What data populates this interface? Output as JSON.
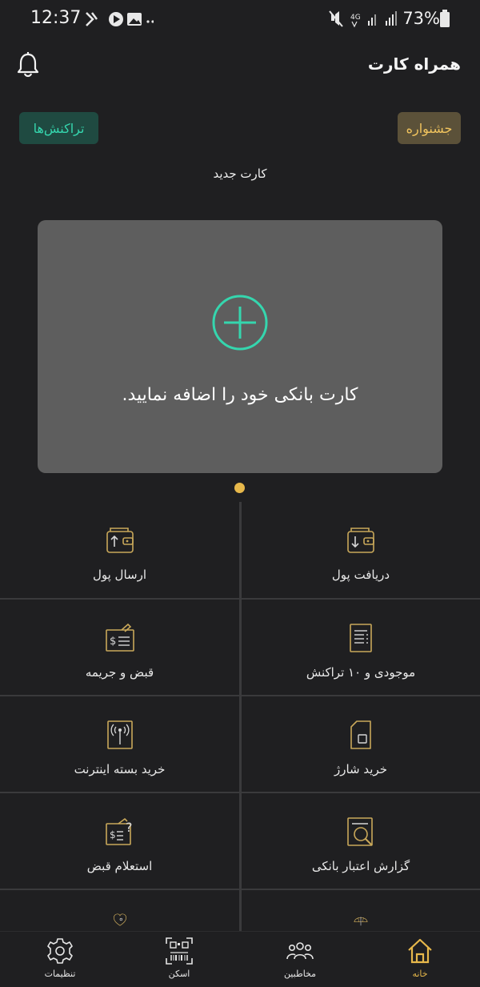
{
  "status_bar": {
    "time": "12:37",
    "network": "4G",
    "battery": "73%"
  },
  "header": {
    "title": "همراه کارت",
    "bell_icon": "bell-icon"
  },
  "top_actions": {
    "transactions_label": "تراکنش‌ها",
    "festival_label": "جشنواره"
  },
  "card_section": {
    "title": "کارت جدید",
    "hint": "کارت بانکی خود را اضافه نمایید."
  },
  "services": [
    {
      "label": "دریافت پول",
      "icon": "wallet-receive-icon"
    },
    {
      "label": "ارسال پول",
      "icon": "wallet-send-icon"
    },
    {
      "label": "موجودی و ۱۰ تراکنش",
      "icon": "receipt-icon"
    },
    {
      "label": "قبض و جریمه",
      "icon": "bill-icon"
    },
    {
      "label": "خرید شارژ",
      "icon": "simcard-icon"
    },
    {
      "label": "خرید بسته اینترنت",
      "icon": "antenna-icon"
    },
    {
      "label": "گزارش اعتبار بانکی",
      "icon": "credit-report-icon"
    },
    {
      "label": "استعلام قبض",
      "icon": "bill-inquiry-icon"
    },
    {
      "label": "",
      "icon": "umbrella-icon"
    },
    {
      "label": "",
      "icon": "heart-icon"
    }
  ],
  "bottom_nav": {
    "home": "خانه",
    "contacts": "مخاطبین",
    "scan": "اسکن",
    "settings": "تنظیمات"
  },
  "colors": {
    "accent_gold": "#e7b84b",
    "accent_teal": "#35d6ae",
    "background": "#1f1f21",
    "card_bg": "#5e5e5e"
  }
}
